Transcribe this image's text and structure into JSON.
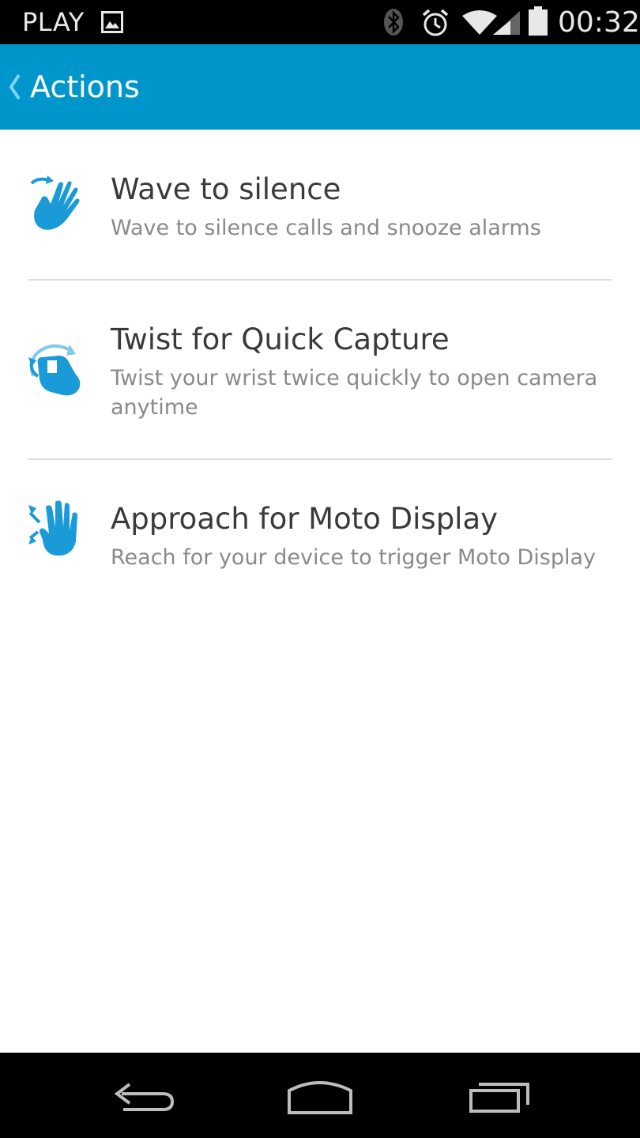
{
  "status_bar": {
    "carrier": "PLAY",
    "time": "00:32"
  },
  "action_bar": {
    "title": "Actions"
  },
  "items": [
    {
      "title": "Wave to silence",
      "subtitle": "Wave to silence calls and snooze alarms",
      "icon": "wave-hand-icon"
    },
    {
      "title": "Twist for Quick Capture",
      "subtitle": "Twist your wrist twice quickly to open camera anytime",
      "icon": "twist-wrist-icon"
    },
    {
      "title": "Approach for Moto Display",
      "subtitle": "Reach for your device to trigger Moto Display",
      "icon": "approach-hand-icon"
    }
  ],
  "colors": {
    "accent": "#0096cc",
    "icon_blue": "#1a9bd7",
    "title_text": "#3a3a3a",
    "subtitle_text": "#8a8a8a"
  }
}
